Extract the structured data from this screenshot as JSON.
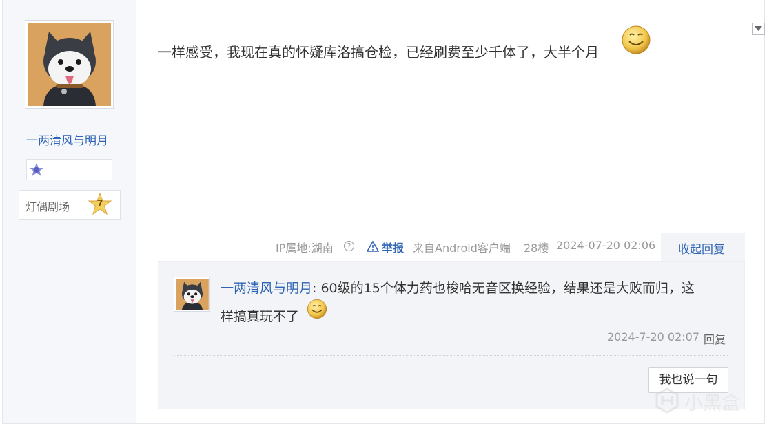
{
  "post": {
    "author": "一两清风与明月",
    "forum_badge": {
      "name": "灯偶剧场",
      "level": "7"
    },
    "content": "一样感受，我现在真的怀疑库洛搞仓检，已经刷费至少千体了，大半个月",
    "meta": {
      "ip_location": "IP属地:湖南",
      "help_icon": "?",
      "report_label": "举报",
      "client": "来自Android客户端",
      "floor": "28楼",
      "time": "2024-07-20 02:06",
      "collapse_label": "收起回复"
    }
  },
  "reply": {
    "author": "一两清风与明月",
    "separator": ":",
    "text_line1": " 60级的15个体力药也梭哈无音区换经验，结果还是大败而归，这",
    "text_line2": "样搞真玩不了",
    "time": "2024-7-20 02:07",
    "reply_label": "回复",
    "say_button": "我也说一句"
  },
  "watermark": {
    "text": "小黑盒"
  },
  "icons": {
    "dropdown": "chevron-down-icon",
    "help": "question-circle-icon",
    "report": "warning-triangle-icon",
    "emoji": "smile-emoji-icon",
    "level": "level-badge-icon",
    "forum_level": "star-badge-icon"
  },
  "colors": {
    "link": "#2d64b3",
    "meta": "#999999",
    "reply_bg": "#f3f4f7",
    "sidebar_bg": "#f6f7fb"
  }
}
